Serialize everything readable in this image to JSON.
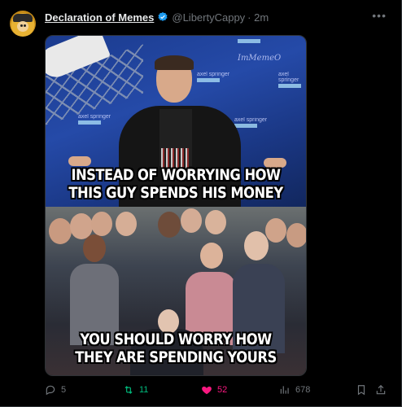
{
  "post": {
    "display_name": "Declaration of Memes",
    "handle": "@LibertyCappy",
    "time": "· 2m",
    "more_icon": "more-horizontal-icon"
  },
  "media": {
    "watermark": "ImMemeO",
    "sponsor_text": "axel springer",
    "top_caption": "INSTEAD OF WORRYING  HOW THIS GUY SPENDS HIS MONEY",
    "bottom_caption": "YOU SHOULD WORRY HOW THEY ARE SPENDING YOURS"
  },
  "actions": {
    "replies": "5",
    "retweets": "11",
    "likes": "52",
    "views": "678"
  },
  "colors": {
    "accent_blue": "#1d9bf0",
    "retweet_green": "#00ba7c",
    "like_pink": "#f91880",
    "muted": "#71767b"
  }
}
